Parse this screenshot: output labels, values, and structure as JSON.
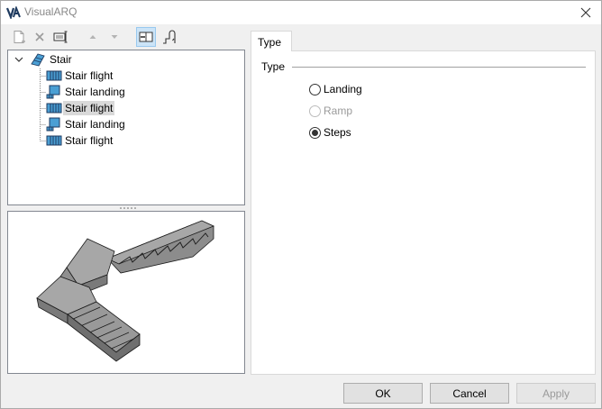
{
  "window": {
    "title": "VisualARQ"
  },
  "tree": {
    "root": "Stair",
    "items": [
      {
        "label": "Stair flight",
        "kind": "flight"
      },
      {
        "label": "Stair landing",
        "kind": "landing"
      },
      {
        "label": "Stair flight",
        "kind": "flight",
        "selected": true
      },
      {
        "label": "Stair landing",
        "kind": "landing"
      },
      {
        "label": "Stair flight",
        "kind": "flight"
      }
    ]
  },
  "tab": {
    "label": "Type"
  },
  "group": {
    "label": "Type",
    "options": [
      {
        "label": "Landing",
        "checked": false,
        "disabled": false
      },
      {
        "label": "Ramp",
        "checked": false,
        "disabled": true
      },
      {
        "label": "Steps",
        "checked": true,
        "disabled": false
      }
    ]
  },
  "buttons": {
    "ok": "OK",
    "cancel": "Cancel",
    "apply": "Apply"
  },
  "colors": {
    "accent": "#1e73be",
    "item_icon": "#4a9fd4",
    "selection": "#d9d9d9"
  }
}
